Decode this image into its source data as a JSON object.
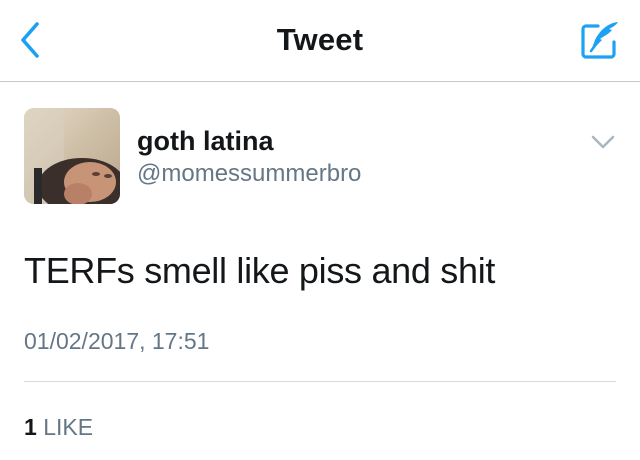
{
  "navbar": {
    "title": "Tweet",
    "back_icon": "chevron-left-icon",
    "compose_icon": "compose-tweet-icon",
    "accent_color": "#1DA1F2"
  },
  "tweet": {
    "author_name": "goth latina",
    "author_handle": "@momessummerbro",
    "text": "TERFs smell like piss and shit",
    "timestamp": "01/02/2017, 17:51",
    "like_count": "1",
    "like_label": "LIKE",
    "menu_icon": "chevron-down-icon"
  }
}
